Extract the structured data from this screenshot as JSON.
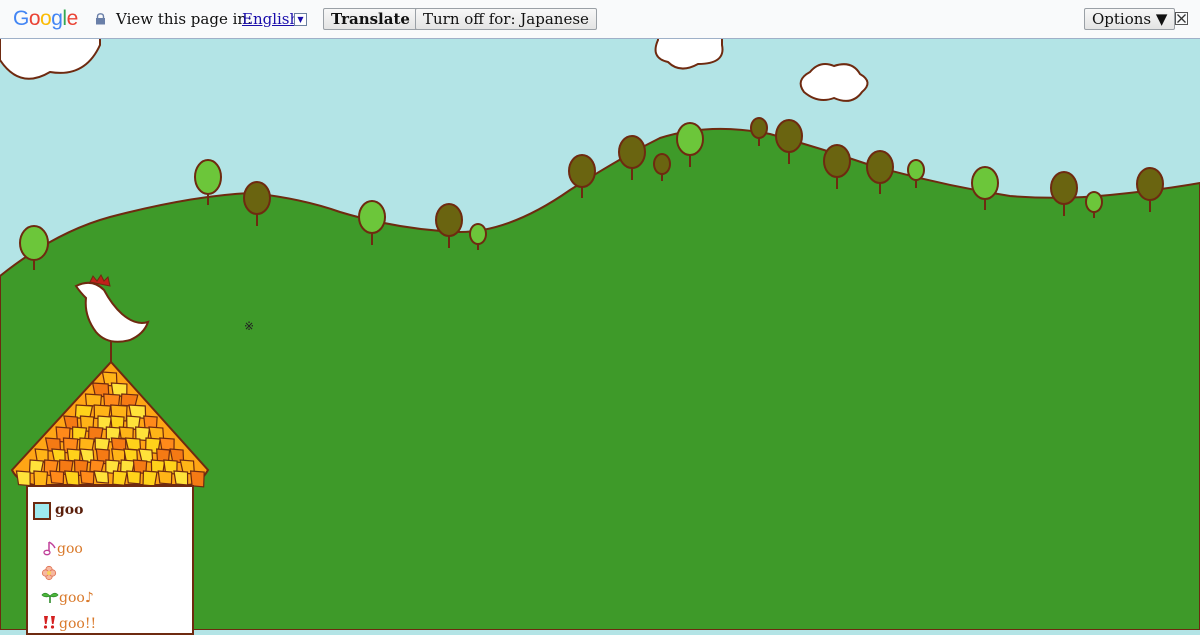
{
  "translate_bar": {
    "logo": "Google",
    "prompt": "View this page in:",
    "language": "English",
    "translate_label": "Translate",
    "turn_off_label": "Turn off for: Japanese",
    "options_label": "Options ▼",
    "icons": [
      "lock-icon",
      "dropdown-arrow-icon",
      "close-icon"
    ]
  },
  "scene": {
    "colors": {
      "sky": "#b3e4e6",
      "hill": "#3e9a29",
      "outline": "#6e2a10",
      "tree_light": "#6cc63a",
      "tree_dark": "#6a6410"
    },
    "mark": "※"
  },
  "sidebar": {
    "title": "goo",
    "items": [
      {
        "icon": "music-note-icon",
        "label": "goo"
      },
      {
        "icon": "flower-icon",
        "label": ""
      },
      {
        "icon": "sprout-icon",
        "label": "goo♪"
      },
      {
        "icon": "double-exclamation-icon",
        "label": "goo!!"
      }
    ]
  }
}
